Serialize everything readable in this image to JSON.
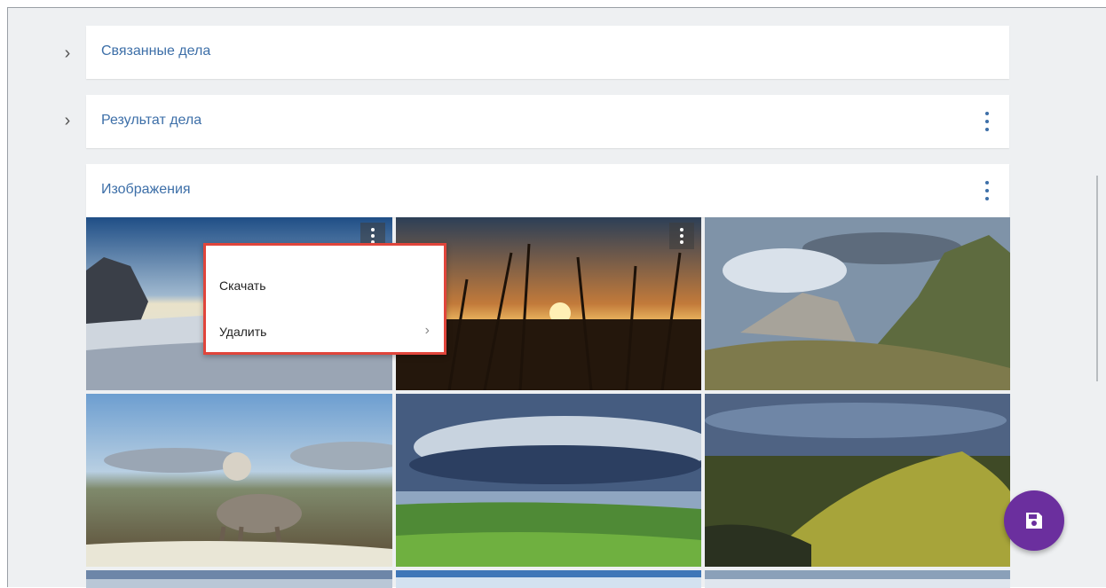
{
  "sections": [
    {
      "title": "Связанные дела",
      "has_menu": false
    },
    {
      "title": "Результат дела",
      "has_menu": true
    },
    {
      "title": "Изображения",
      "has_menu": true
    }
  ],
  "expand_icon": "chevron-right-icon",
  "more_icon": "more-vert-icon",
  "context_menu": {
    "items": [
      {
        "label": "Скачать",
        "has_submenu": false
      },
      {
        "label": "Удалить",
        "has_submenu": true
      }
    ],
    "submenu_icon": "chevron-right-icon",
    "highlight_color": "#e0453b"
  },
  "images": [
    {
      "subject": "snowy-mountain-sunset"
    },
    {
      "subject": "reeds-at-sunset"
    },
    {
      "subject": "rocky-mountains-clouds"
    },
    {
      "subject": "arctic-fox-meadow"
    },
    {
      "subject": "storm-cloud-over-river"
    },
    {
      "subject": "green-hills-sunlight"
    },
    {
      "subject": "landscape-partial-1"
    },
    {
      "subject": "landscape-partial-2"
    },
    {
      "subject": "landscape-partial-3"
    }
  ],
  "fab": {
    "icon": "save-icon",
    "color": "#6b2f9e"
  },
  "colors": {
    "accent": "#3d6fa8",
    "background": "#eef0f2"
  }
}
